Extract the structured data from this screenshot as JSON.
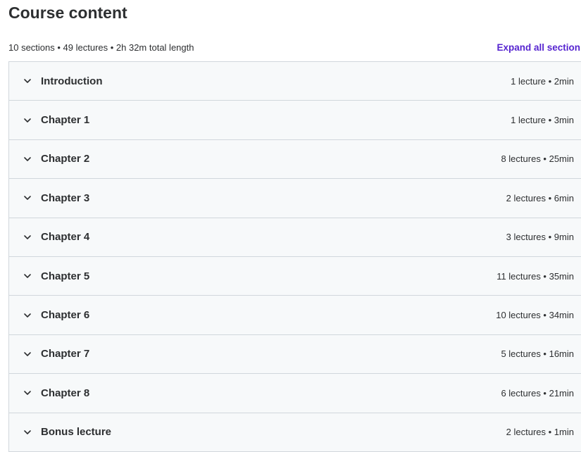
{
  "course": {
    "title": "Course content",
    "summary": "10 sections • 49 lectures • 2h 32m total length",
    "expand_all_label": "Expand all section"
  },
  "sections": [
    {
      "title": "Introduction",
      "meta": "1 lecture • 2min"
    },
    {
      "title": "Chapter 1",
      "meta": "1 lecture • 3min"
    },
    {
      "title": "Chapter 2",
      "meta": "8 lectures • 25min"
    },
    {
      "title": "Chapter 3",
      "meta": "2 lectures • 6min"
    },
    {
      "title": "Chapter 4",
      "meta": "3 lectures • 9min"
    },
    {
      "title": "Chapter 5",
      "meta": "11 lectures • 35min"
    },
    {
      "title": "Chapter 6",
      "meta": "10 lectures • 34min"
    },
    {
      "title": "Chapter 7",
      "meta": "5 lectures • 16min"
    },
    {
      "title": "Chapter 8",
      "meta": "6 lectures • 21min"
    },
    {
      "title": "Bonus lecture",
      "meta": "2 lectures • 1min"
    }
  ],
  "icons": {
    "section_toggle": "chevron-down-icon"
  },
  "colors": {
    "accent": "#5624d0",
    "text": "#2d2f31",
    "row_background": "#f7f9fa",
    "border": "#d1d7dc"
  }
}
